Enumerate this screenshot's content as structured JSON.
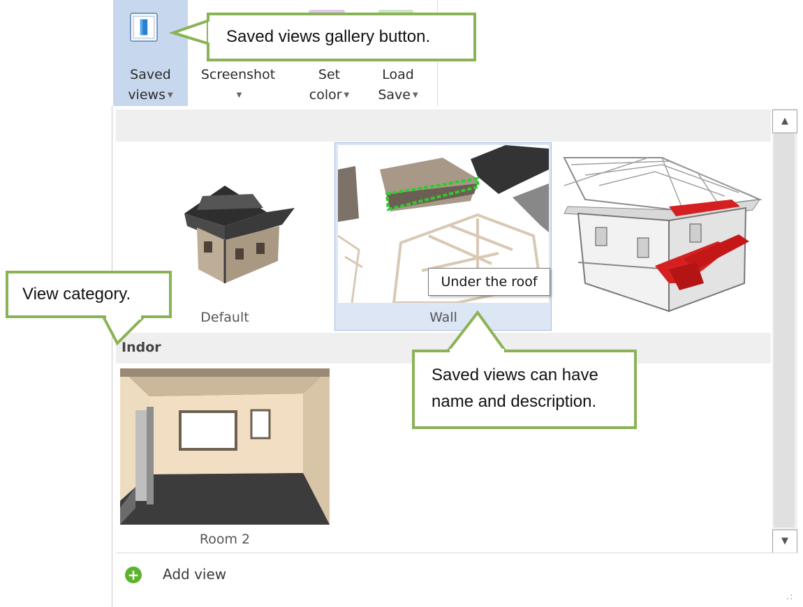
{
  "ribbon": {
    "saved_views": {
      "line1": "Saved",
      "line2": "views"
    },
    "screenshot": {
      "line1": "Screenshot"
    },
    "set_color": {
      "line1": "Set",
      "line2": "color"
    },
    "load_save": {
      "line1": "Load",
      "line2": "Save"
    }
  },
  "gallery": {
    "groups": [
      {
        "category": "",
        "views": [
          {
            "name": "Default",
            "selected": false
          },
          {
            "name": "Wall",
            "selected": true,
            "tooltip": "Under the roof"
          },
          {
            "name": "",
            "selected": false
          }
        ]
      },
      {
        "category": "Indor",
        "views": [
          {
            "name": "Room 2",
            "selected": false
          }
        ]
      }
    ],
    "add_view_label": "Add view"
  },
  "callouts": {
    "button": "Saved views gallery button.",
    "category": "View category.",
    "description_line1": "Saved views can have",
    "description_line2": "name and description."
  },
  "colors": {
    "callout_border": "#8ab356",
    "selected_bg": "#dce6f5",
    "ribbon_active": "#c7d8ee",
    "highlight_red": "#d42020",
    "selection_green": "#2ecc2e"
  },
  "icons": {
    "saved_views": "saved-views-icon",
    "add": "plus-circle-icon",
    "scroll_up": "chevron-up-icon",
    "scroll_down": "chevron-down-icon"
  }
}
